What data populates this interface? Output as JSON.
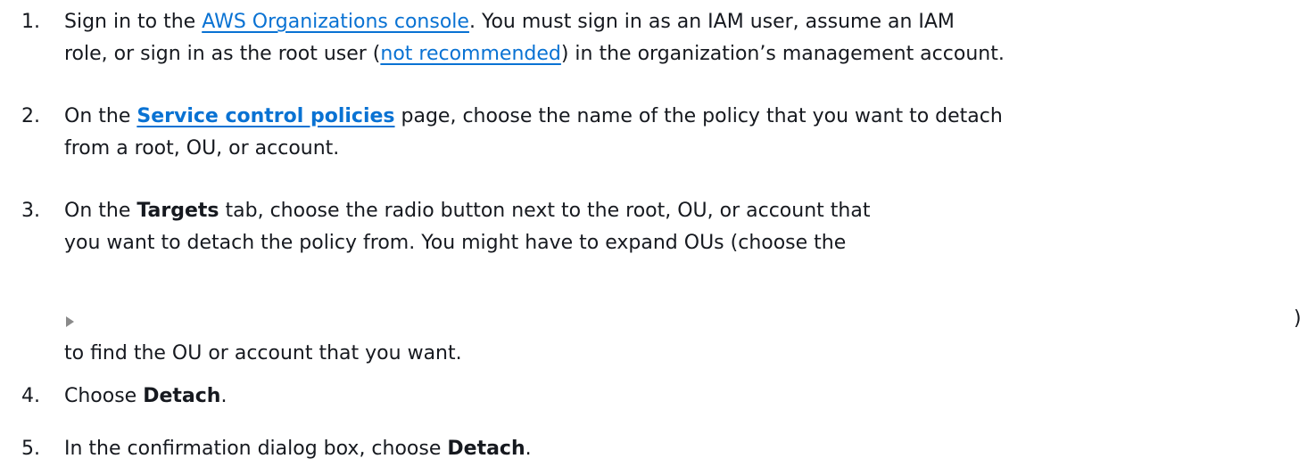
{
  "steps": [
    {
      "number": "1.",
      "line1_pre": "Sign in to the ",
      "link": "AWS Organizations console",
      "line1_post": ". You must sign in as an IAM user, assume an IAM",
      "line2_pre": "role, or sign in as the root user (",
      "link2": "not recommended",
      "line2_post": ") in the organization’s management account."
    },
    {
      "number": "2.",
      "line1_pre": "On the ",
      "link": "Service control policies",
      "line1_post": " page, choose the name of the policy that you want to detach",
      "line2": "from a root, OU, or account."
    },
    {
      "number": "3.",
      "line1_pre": "On the ",
      "bold": "Targets",
      "line1_post": " tab, choose the radio button next to the root, OU, or account that",
      "line2": "you want to detach the policy from. You might have to expand OUs (choose the",
      "close_paren": ")",
      "line4": "to find the OU or account that you want."
    },
    {
      "number": "4.",
      "pre": "Choose ",
      "bold": "Detach",
      "post": "."
    },
    {
      "number": "5.",
      "pre": "In the confirmation dialog box, choose ",
      "bold": "Detach",
      "post": "."
    }
  ],
  "icons": {
    "expand": "expand-caret-icon"
  },
  "colors": {
    "link": "#0972d3",
    "text": "#16191f",
    "icon": "#8a8a8a"
  }
}
